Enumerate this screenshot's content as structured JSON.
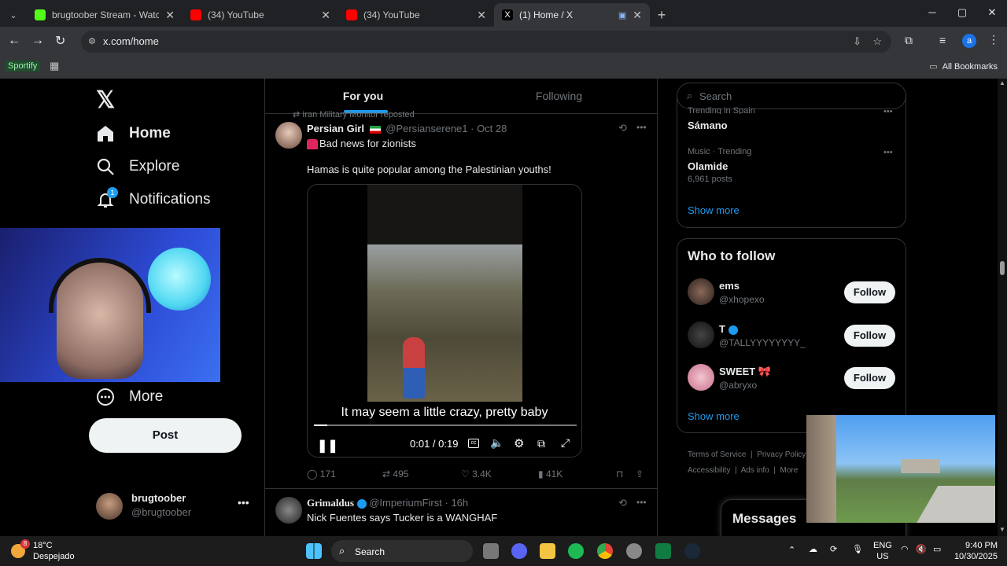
{
  "browser": {
    "tabs": [
      {
        "title": "brugtoober Stream - Watch Live",
        "favicon_color": "#53fc18"
      },
      {
        "title": "(34) YouTube",
        "favicon_color": "#ff0000"
      },
      {
        "title": "(34) YouTube",
        "favicon_color": "#ff0000"
      },
      {
        "title": "(1) Home / X",
        "favicon_color": "#ffffff"
      }
    ],
    "url": "x.com/home",
    "profile_initial": "a",
    "bookmarks": {
      "first": "Sportify",
      "all": "All Bookmarks"
    }
  },
  "sidebar": {
    "home": "Home",
    "explore": "Explore",
    "notifications": "Notifications",
    "notifications_badge": "1",
    "more": "More",
    "post": "Post",
    "account": {
      "name": "brugtoober",
      "handle": "@brugtoober"
    }
  },
  "feed": {
    "tabs": [
      "For you",
      "Following"
    ],
    "tweet1": {
      "repost_note": "Iran Military Monitor reposted",
      "name": "Persian Girl",
      "handle": "@Persianserene1",
      "date": "· Oct 28",
      "line1": "Bad news for zionists",
      "line2": "Hamas is quite popular among the Palestinian youths!",
      "caption": "It may seem a little crazy, pretty baby",
      "time": "0:01 / 0:19",
      "progress": 0.05,
      "replies": "171",
      "reposts": "495",
      "likes": "3.4K",
      "views": "41K"
    },
    "tweet2": {
      "name": "Grimaldus",
      "handle": "@ImperiumFirst",
      "date": "· 16h",
      "text": "Nick Fuentes says Tucker is a WANGHAF"
    }
  },
  "right": {
    "search_placeholder": "Search",
    "trend_top_name": "Sámano",
    "trend_top_meta": "Trending in Spain",
    "trend2_meta": "Music · Trending",
    "trend2_name": "Olamide",
    "trend2_posts": "6,961 posts",
    "show_more": "Show more",
    "who_title": "Who to follow",
    "follow_label": "Follow",
    "users": [
      {
        "name": "ems",
        "handle": "@xhopexo"
      },
      {
        "name": "T",
        "handle": "@TALLYYYYYYYY_"
      },
      {
        "name": "SWEET 🎀",
        "handle": "@abryxo"
      }
    ],
    "footer": [
      "Terms of Service",
      "Privacy Policy",
      "Accessibility",
      "Ads info",
      "More"
    ],
    "messages": "Messages"
  },
  "taskbar": {
    "weather_temp": "18°C",
    "weather_desc": "Despejado",
    "weather_badge": "8",
    "search": "Search",
    "lang1": "ENG",
    "lang2": "US",
    "time": "9:40 PM",
    "date": "10/30/2025"
  }
}
